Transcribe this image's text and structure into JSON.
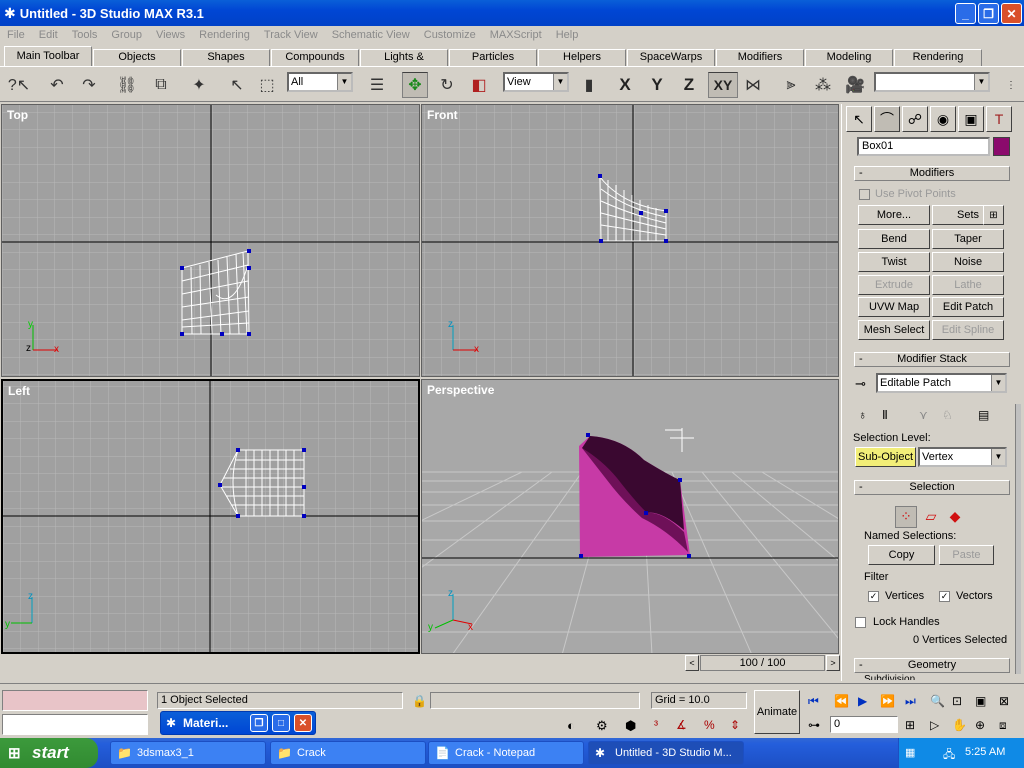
{
  "window": {
    "title": "Untitled - 3D Studio MAX R3.1"
  },
  "menu": [
    "File",
    "Edit",
    "Tools",
    "Group",
    "Views",
    "Rendering",
    "Track View",
    "Schematic View",
    "Customize",
    "MAXScript",
    "Help"
  ],
  "tabs": [
    "Main Toolbar",
    "Objects",
    "Shapes",
    "Compounds",
    "Lights & Cameras",
    "Particles",
    "Helpers",
    "SpaceWarps",
    "Modifiers",
    "Modeling",
    "Rendering"
  ],
  "toolbar": {
    "selection_filter": "All",
    "ref_coord": "View",
    "axis_x": "X",
    "axis_y": "Y",
    "axis_z": "Z",
    "axis_xy": "XY",
    "named_sel": ""
  },
  "viewports": {
    "top": "Top",
    "front": "Front",
    "left": "Left",
    "perspective": "Perspective"
  },
  "command_panel": {
    "object_name": "Box01",
    "object_color": "#8b0a6c",
    "modifiers_title": "Modifiers",
    "use_pivot": "Use Pivot Points",
    "more": "More...",
    "sets": "Sets",
    "buttons": [
      "Bend",
      "Taper",
      "Twist",
      "Noise",
      "Extrude",
      "Lathe",
      "UVW Map",
      "Edit Patch",
      "Mesh Select",
      "Edit Spline"
    ],
    "stack_title": "Modifier Stack",
    "stack_value": "Editable Patch",
    "selection_level": "Selection Level:",
    "sub_object": "Sub-Object",
    "level_value": "Vertex",
    "selection_title": "Selection",
    "named_selections": "Named Selections:",
    "copy": "Copy",
    "paste": "Paste",
    "filter": "Filter",
    "vertices": "Vertices",
    "vectors": "Vectors",
    "lock_handles": "Lock Handles",
    "vertices_selected": "0 Vertices Selected",
    "geometry": "Geometry",
    "subdivision": "Subdivision"
  },
  "timeslider": {
    "frame": "100 / 100"
  },
  "status": {
    "selected": "1 Object Selected",
    "grid": "Grid = 10.0",
    "animate": "Animate",
    "frame_field": "0"
  },
  "material_window": {
    "title": "Materi..."
  },
  "taskbar": {
    "start": "start",
    "items": [
      "3dsmax3_1",
      "Crack",
      "Crack - Notepad",
      "Untitled - 3D Studio M..."
    ],
    "clock": "5:25 AM"
  }
}
